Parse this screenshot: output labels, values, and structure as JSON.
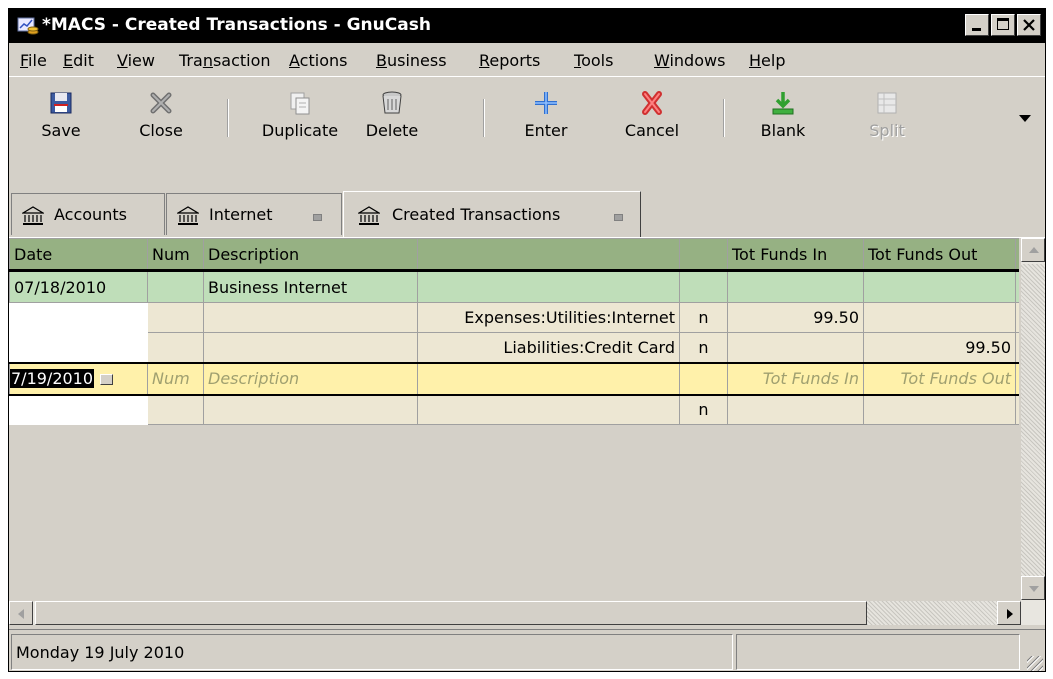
{
  "window": {
    "title": "*MACS - Created Transactions - GnuCash",
    "controls": [
      "minimize",
      "maximize",
      "close"
    ]
  },
  "menubar": {
    "items": [
      {
        "pre": "",
        "key": "F",
        "post": "ile"
      },
      {
        "pre": "",
        "key": "E",
        "post": "dit"
      },
      {
        "pre": "",
        "key": "V",
        "post": "iew"
      },
      {
        "pre": "Tra",
        "key": "n",
        "post": "saction"
      },
      {
        "pre": "",
        "key": "A",
        "post": "ctions"
      },
      {
        "pre": "",
        "key": "B",
        "post": "usiness"
      },
      {
        "pre": "",
        "key": "R",
        "post": "eports"
      },
      {
        "pre": "",
        "key": "T",
        "post": "ools"
      },
      {
        "pre": "",
        "key": "W",
        "post": "indows"
      },
      {
        "pre": "",
        "key": "H",
        "post": "elp"
      }
    ]
  },
  "toolbar": {
    "save": "Save",
    "close": "Close",
    "duplicate": "Duplicate",
    "delete": "Delete",
    "enter": "Enter",
    "cancel": "Cancel",
    "blank": "Blank",
    "split": "Split"
  },
  "tabs": [
    {
      "label": "Accounts",
      "active": false
    },
    {
      "label": "Internet",
      "active": false
    },
    {
      "label": "Created Transactions",
      "active": true
    }
  ],
  "register": {
    "headers": {
      "date": "Date",
      "num": "Num",
      "description": "Description",
      "transfer": "",
      "reconcile": "",
      "funds_in": "Tot Funds In",
      "funds_out": "Tot Funds Out"
    },
    "transaction": {
      "date": "07/18/2010",
      "num": "",
      "description": "Business Internet",
      "funds_in": "",
      "funds_out": ""
    },
    "splits": [
      {
        "account": "Expenses:Utilities:Internet",
        "reconcile": "n",
        "funds_in": "99.50",
        "funds_out": ""
      },
      {
        "account": "Liabilities:Credit Card",
        "reconcile": "n",
        "funds_in": "",
        "funds_out": "99.50"
      }
    ],
    "new_entry": {
      "date": "7/19/2010",
      "num_placeholder": "Num",
      "description_placeholder": "Description",
      "funds_in_placeholder": "Tot Funds In",
      "funds_out_placeholder": "Tot Funds Out"
    },
    "new_split": {
      "reconcile": "n"
    }
  },
  "status": {
    "text": "Monday 19 July 2010"
  },
  "colors": {
    "header": "#96b183",
    "transaction_row": "#bfdeb9",
    "split_row": "#ede7d3",
    "cursor_row": "#fff1aa"
  }
}
